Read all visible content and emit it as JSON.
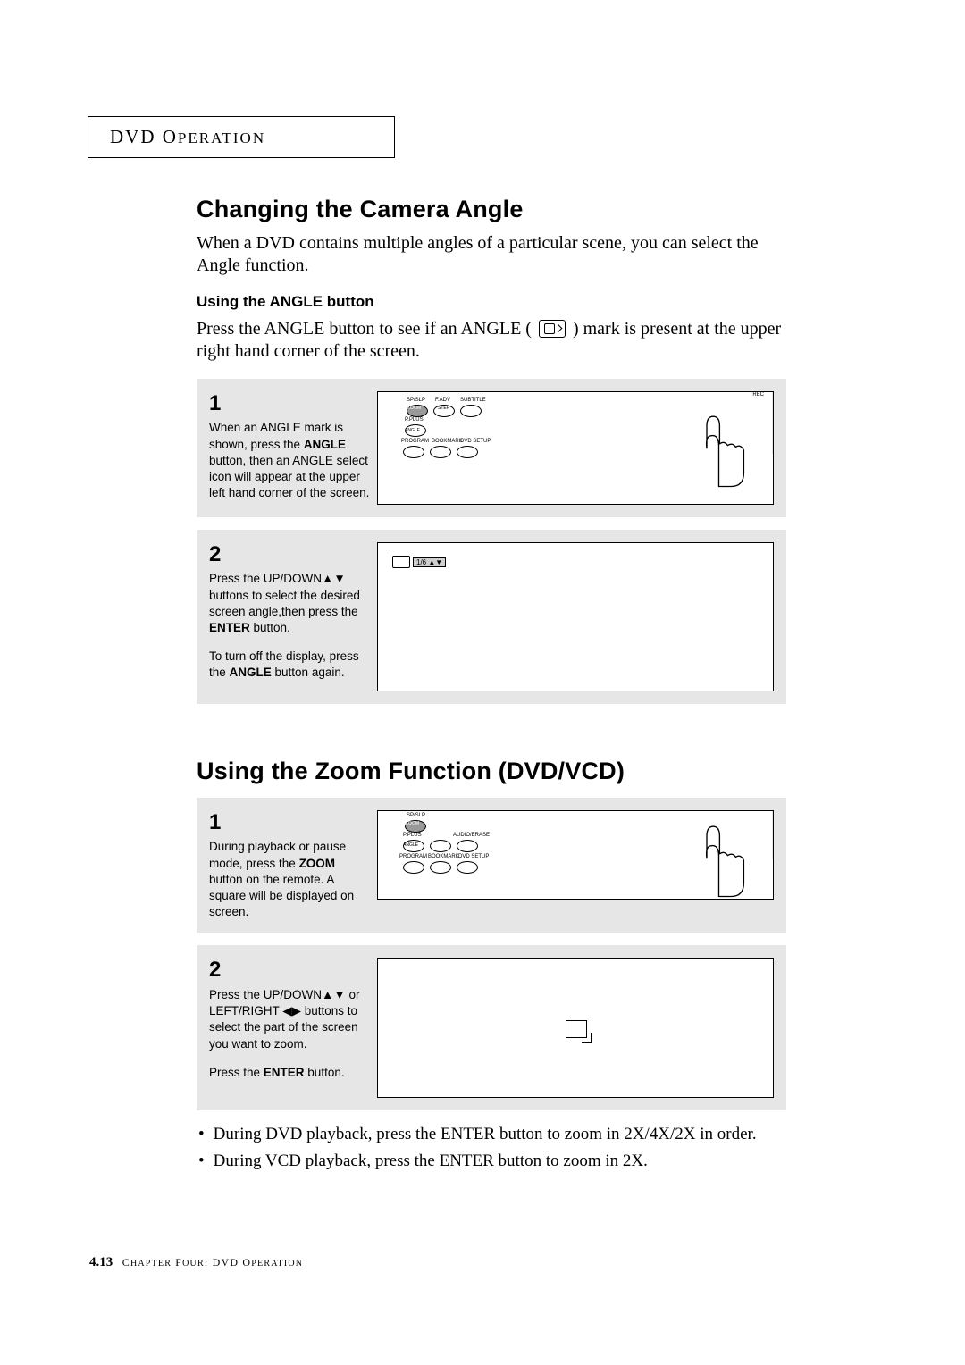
{
  "header": "DVD Operation",
  "section1": {
    "title": "Changing the Camera Angle",
    "intro": "When a DVD contains multiple angles of a particular scene, you can select the Angle function.",
    "sub": "Using the ANGLE button",
    "sub_intro_a": "Press the ANGLE button to see if an ANGLE ( ",
    "sub_intro_b": " ) mark is present at the upper right hand corner of the screen.",
    "steps": [
      {
        "num": "1",
        "text_a": "When an ANGLE mark is shown, press the ",
        "bold1": "ANGLE",
        "text_b": " button, then an ANGLE select icon will appear at the upper left hand corner of the screen."
      },
      {
        "num": "2",
        "text_a": "Press the UP/DOWN▲▼ buttons to select the desired screen angle,then press the ",
        "bold1": "ENTER",
        "text_b": " button.",
        "text_c": "To turn off the display, press the ",
        "bold2": "ANGLE",
        "text_d": " button again.",
        "badge": "1/6 ▲▼"
      }
    ]
  },
  "section2": {
    "title": "Using the Zoom Function (DVD/VCD)",
    "steps": [
      {
        "num": "1",
        "text_a": "During playback or pause mode, press the ",
        "bold1": "ZOOM",
        "text_b": " button on the remote. A square will be displayed on screen."
      },
      {
        "num": "2",
        "text_a": "Press the UP/DOWN▲▼ or LEFT/RIGHT ◀▶ buttons to select the part of the screen you want to zoom.",
        "text_b": "Press the ",
        "bold1": "ENTER",
        "text_c": " button."
      }
    ],
    "notes": [
      "During DVD playback, press the ENTER button to zoom in 2X/4X/2X in order.",
      "During VCD playback, press the ENTER button to zoom in 2X."
    ]
  },
  "remote_labels": {
    "r1": [
      "SP/SLP",
      "F.ADV",
      "SUBTITLE"
    ],
    "r2": [
      "ZOOM",
      "STEP",
      ""
    ],
    "r3": [
      "P.PLUS",
      "",
      ""
    ],
    "r4": [
      "ANGLE",
      "",
      ""
    ],
    "r5": [
      "PROGRAM",
      "BOOKMARK",
      "DVD SETUP"
    ],
    "rec": "REC",
    "audio": "AUDIO/ERASE"
  },
  "footer": {
    "page": "4.13",
    "chapter": "Chapter Four: DVD Operation"
  }
}
